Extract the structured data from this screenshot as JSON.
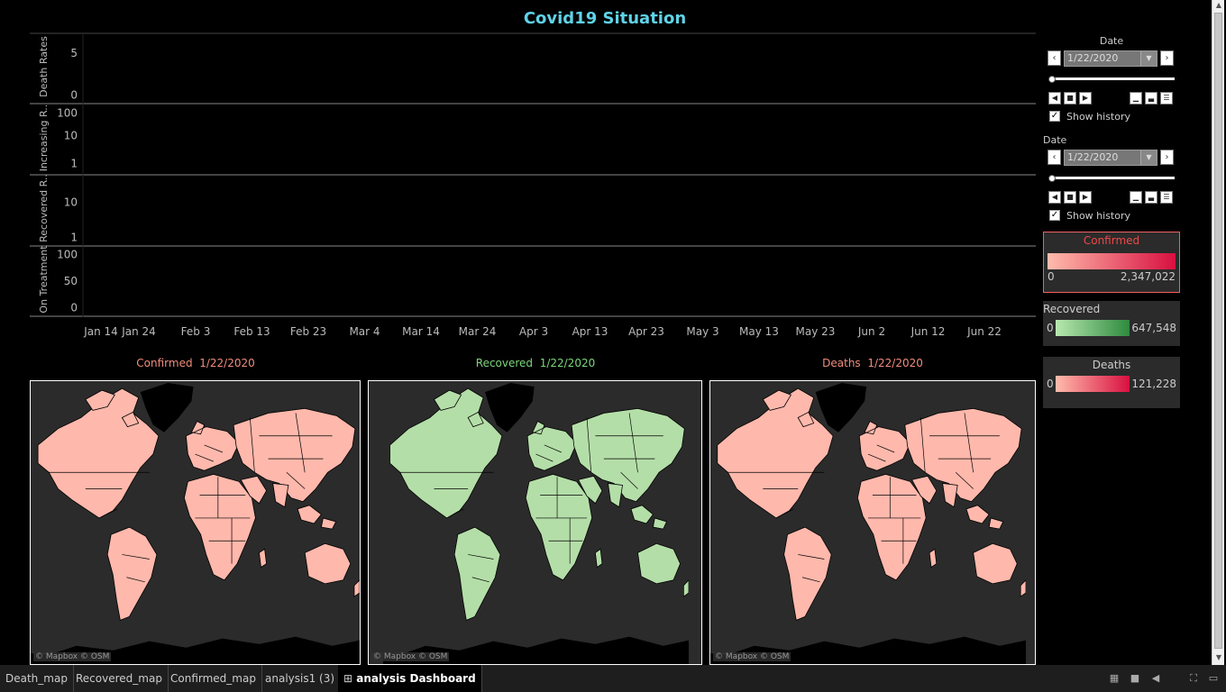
{
  "dashboard_title": "Covid19 Situation",
  "chart_data": {
    "type": "line",
    "x_tick_labels": [
      "Jan 14",
      "Jan 24",
      "Feb 3",
      "Feb 13",
      "Feb 23",
      "Mar 4",
      "Mar 14",
      "Mar 24",
      "Apr 3",
      "Apr 13",
      "Apr 23",
      "May 3",
      "May 13",
      "May 23",
      "Jun 2",
      "Jun 12",
      "Jun 22"
    ],
    "panes": [
      {
        "ylabel": "Death Rates",
        "scale": "linear",
        "ticks": [
          "5",
          "0"
        ]
      },
      {
        "ylabel": "Increasing R..",
        "scale": "log",
        "ticks": [
          "100",
          "10",
          "1"
        ]
      },
      {
        "ylabel": "Recovered R..",
        "scale": "log",
        "ticks": [
          "10",
          "1"
        ]
      },
      {
        "ylabel": "On Treatment",
        "scale": "linear",
        "ticks": [
          "100",
          "50",
          "0"
        ]
      }
    ],
    "series": []
  },
  "maps": [
    {
      "title": "Confirmed",
      "date": "1/22/2020",
      "title_color": "#f08c7c",
      "fill": "#ffb8ac",
      "attribution": "© Mapbox © OSM"
    },
    {
      "title": "Recovered",
      "date": "1/22/2020",
      "title_color": "#7cd67c",
      "fill": "#b4dea8",
      "attribution": "© Mapbox © OSM"
    },
    {
      "title": "Deaths",
      "date": "1/22/2020",
      "title_color": "#f08c7c",
      "fill": "#ffb8ac",
      "attribution": "© Mapbox © OSM"
    }
  ],
  "filters": [
    {
      "label": "Date",
      "value": "1/22/2020",
      "show_history": "Show history",
      "show_history_checked": true
    },
    {
      "label": "Date",
      "value": "1/22/2020",
      "show_history": "Show history",
      "show_history_checked": true
    }
  ],
  "legends": [
    {
      "title": "Confirmed",
      "min": "0",
      "max": "2,347,022",
      "title_color": "#f04848",
      "from": "#ffbcac",
      "to": "#d81040"
    },
    {
      "title": "Recovered",
      "min": "0",
      "max": "647,548",
      "title_color": "#cccccc",
      "from": "#b8e8b0",
      "to": "#2e8a3e"
    },
    {
      "title": "Deaths",
      "min": "0",
      "max": "121,228",
      "title_color": "#cccccc",
      "from": "#ffbcac",
      "to": "#d81040"
    }
  ],
  "tabs": [
    {
      "label": "Death_map",
      "active": false
    },
    {
      "label": "Recovered_map",
      "active": false
    },
    {
      "label": "Confirmed_map",
      "active": false
    },
    {
      "label": "analysis1 (3)",
      "active": false
    },
    {
      "label": "analysis Dashboard",
      "active": true
    }
  ]
}
